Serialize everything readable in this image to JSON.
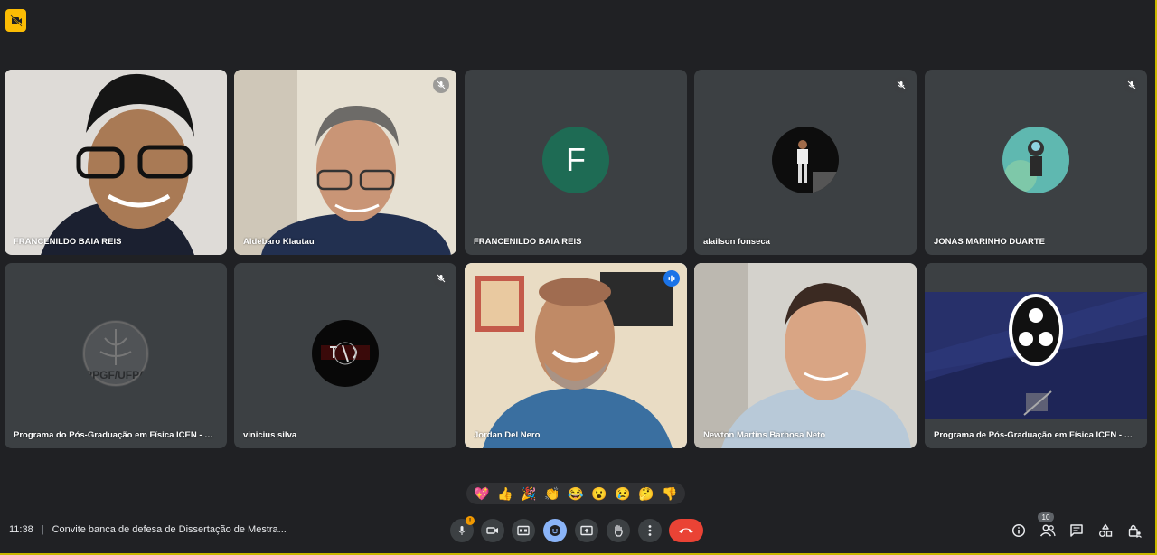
{
  "participants": [
    {
      "name": "FRANCENILDO BAIA REIS",
      "muted": false,
      "mode": "video"
    },
    {
      "name": "Aldebaro Klautau",
      "muted": true,
      "mode": "video"
    },
    {
      "name": "FRANCENILDO BAIA REIS",
      "muted": false,
      "mode": "avatar-letter",
      "initial": "F"
    },
    {
      "name": "alailson fonseca",
      "muted": true,
      "mode": "avatar-photo"
    },
    {
      "name": "JONAS MARINHO DUARTE",
      "muted": true,
      "mode": "avatar-photo"
    },
    {
      "name": "Programa do Pós-Graduação em Física ICEN - U...",
      "muted": false,
      "mode": "avatar-logo",
      "logo_text": "PPGF/UFPA"
    },
    {
      "name": "vinicius silva",
      "muted": true,
      "mode": "avatar-photo"
    },
    {
      "name": "Jordan Del Nero",
      "muted": false,
      "mode": "video",
      "speaking": true
    },
    {
      "name": "Newton Martins Barbosa Neto",
      "muted": false,
      "mode": "video"
    },
    {
      "name": "Programa de Pós-Graduação em Física ICEN - U...",
      "muted": false,
      "mode": "screen-obs"
    }
  ],
  "reactions": [
    "💖",
    "👍",
    "🎉",
    "👏",
    "😂",
    "😮",
    "😢",
    "🤔",
    "👎"
  ],
  "meeting": {
    "time": "11:38",
    "separator": "|",
    "title": "Convite banca de defesa de Dissertação de Mestra..."
  },
  "controls": {
    "mic_alert": "!",
    "participant_count": "10"
  },
  "colors": {
    "background": "#202124",
    "tile": "#3c4043",
    "accent_blue": "#8ab4f8",
    "end_call": "#ea4335",
    "recording_badge": "#fbbc04",
    "avatar_green": "#1e6b54"
  }
}
